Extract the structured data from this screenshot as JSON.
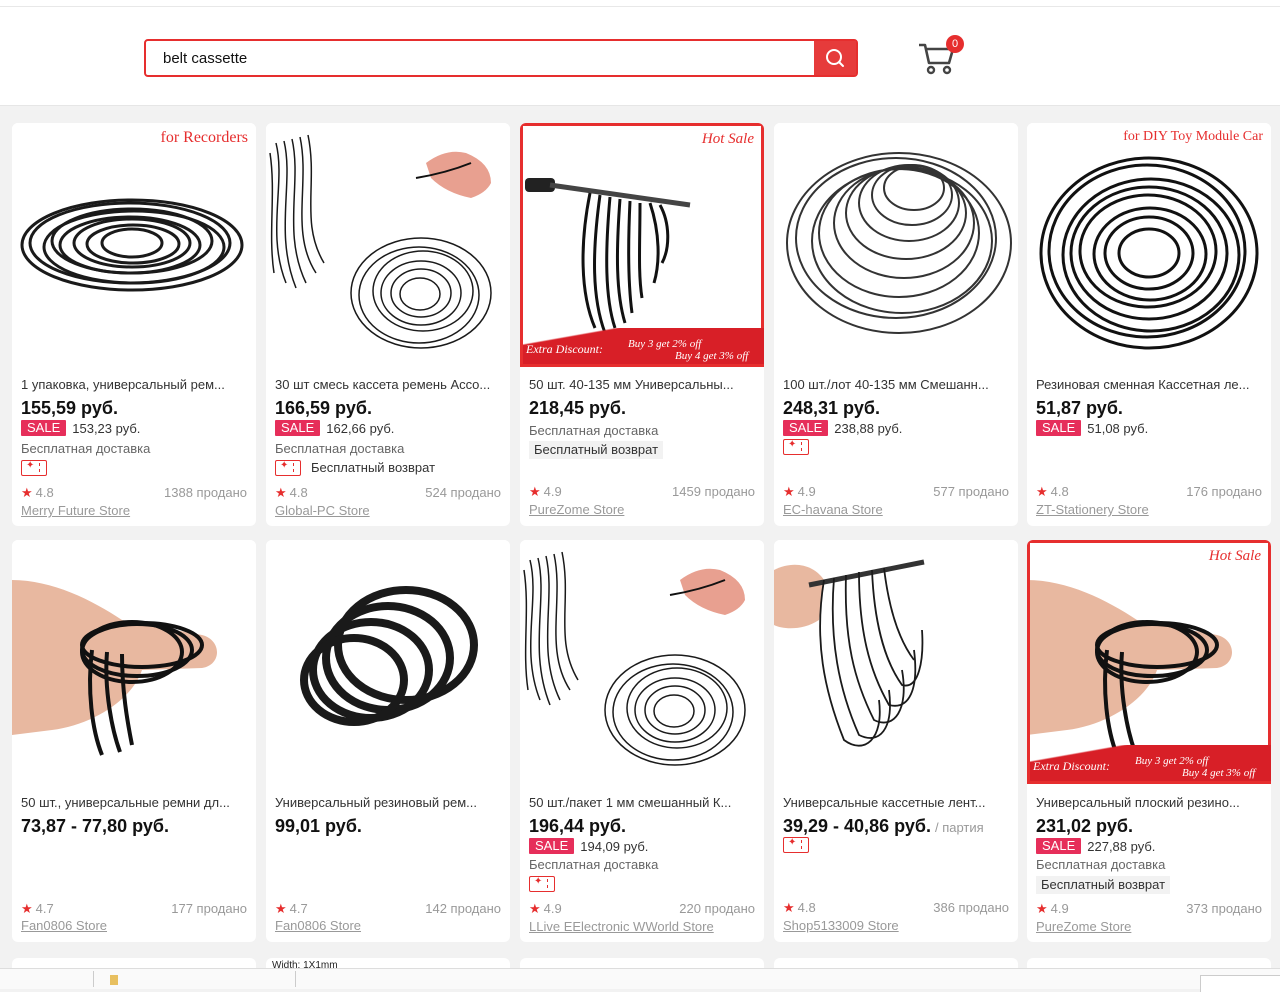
{
  "search": {
    "value": "belt cassette"
  },
  "cart": {
    "count": "0"
  },
  "products": [
    {
      "title": "1 упаковка, универсальный рем...",
      "price": "155,59 руб.",
      "sale_label": "SALE",
      "sale_price": "153,23 руб.",
      "shipping": "Бесплатная доставка",
      "coupon": true,
      "return": "",
      "rating": "4.8",
      "sold": "1388 продано",
      "store": "Merry Future Store",
      "corner": "for Recorders"
    },
    {
      "title": "30 шт смесь кассета ремень Acco...",
      "price": "166,59 руб.",
      "sale_label": "SALE",
      "sale_price": "162,66 руб.",
      "shipping": "Бесплатная доставка",
      "coupon": true,
      "return": "Бесплатный возврат",
      "rating": "4.8",
      "sold": "524 продано",
      "store": "Global-PC Store"
    },
    {
      "title": "50 шт. 40-135 мм Универсальны...",
      "price": "218,45 руб.",
      "shipping": "Бесплатная доставка",
      "return": "Бесплатный возврат",
      "rating": "4.9",
      "sold": "1459 продано",
      "store": "PureZome Store",
      "hot": "Hot Sale",
      "extra1": "Extra Discount:",
      "extra2": "Buy 3 get 2% off",
      "extra3": "Buy 4 get 3% off"
    },
    {
      "title": "100 шт./лот 40-135 мм Смешанн...",
      "price": "248,31 руб.",
      "sale_label": "SALE",
      "sale_price": "238,88 руб.",
      "coupon": true,
      "rating": "4.9",
      "sold": "577 продано",
      "store": "EC-havana Store"
    },
    {
      "title": "Резиновая сменная Кассетная ле...",
      "price": "51,87 руб.",
      "sale_label": "SALE",
      "sale_price": "51,08 руб.",
      "rating": "4.8",
      "sold": "176 продано",
      "store": "ZT-Stationery Store",
      "corner": "for DIY Toy Module Car"
    },
    {
      "title": "50 шт., универсальные ремни дл...",
      "price": "73,87 - 77,80 руб.",
      "rating": "4.7",
      "sold": "177 продано",
      "store": "Fan0806 Store"
    },
    {
      "title": "Универсальный резиновый рем...",
      "price": "99,01 руб.",
      "rating": "4.7",
      "sold": "142 продано",
      "store": "Fan0806 Store"
    },
    {
      "title": "50 шт./пакет 1 мм смешанный К...",
      "price": "196,44 руб.",
      "sale_label": "SALE",
      "sale_price": "194,09 руб.",
      "shipping": "Бесплатная доставка",
      "coupon": true,
      "rating": "4.9",
      "sold": "220 продано",
      "store": "LLive EElectronic WWorld Store"
    },
    {
      "title": "Универсальные кассетные лент...",
      "price": "39,29 - 40,86 руб.",
      "unit": "/ партия",
      "coupon": true,
      "rating": "4.8",
      "sold": "386 продано",
      "store": "Shop5133009 Store"
    },
    {
      "title": "Универсальный плоский резино...",
      "price": "231,02 руб.",
      "sale_label": "SALE",
      "sale_price": "227,88 руб.",
      "shipping": "Бесплатная доставка",
      "return": "Бесплатный возврат",
      "rating": "4.9",
      "sold": "373 продано",
      "store": "PureZome Store",
      "hot": "Hot Sale",
      "extra1": "Extra Discount:",
      "extra2": "Buy 3 get 2% off",
      "extra3": "Buy 4 get 3% off"
    }
  ],
  "peek": {
    "text": "Width: 1X1mm"
  }
}
